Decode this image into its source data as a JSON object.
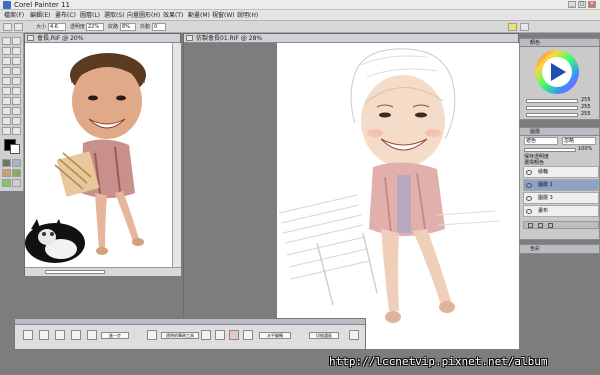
{
  "app": {
    "title": "Corel Painter 11",
    "window_controls": [
      "_",
      "□",
      "×"
    ]
  },
  "menu": [
    "檔案(F)",
    "編輯(E)",
    "畫布(C)",
    "圖層(L)",
    "選取(S)",
    "向量圖形(H)",
    "效果(T)",
    "動畫(M)",
    "視窗(W)",
    "說明(H)"
  ],
  "propbar": {
    "size_label": "大小",
    "size_value": "4.6",
    "opacity_label": "透明度",
    "opacity_value": "22%",
    "grain_label": "紋路",
    "grain_value": "8%",
    "resat_label": "抖動",
    "resat_value": "0"
  },
  "documents": {
    "source_title": "會長.RIF @ 20%",
    "target_title": "仿製會長01.RIF @ 28%"
  },
  "panels": {
    "color_title": "顏色",
    "color_values": [
      "255",
      "255",
      "255"
    ],
    "layers_title": "圖層",
    "blend_mode": "遮色",
    "composite": "忽略",
    "opacity": "100%",
    "options": [
      "保存透明度",
      "選擇顏色"
    ],
    "layers": [
      {
        "name": "繪輪"
      },
      {
        "name": "圖層 1",
        "selected": true
      },
      {
        "name": "圖層 3"
      },
      {
        "name": "畫布"
      }
    ],
    "bottom_title": "色彩"
  },
  "bottombar": {
    "buttons": [
      "進一步",
      "透明的筆刷工具",
      "水平翻轉",
      "切換選區"
    ]
  },
  "watermark": "http://lccnetvip.pixnet.net/album",
  "colors": {
    "canvas_gray": "#7d7d7d",
    "panel_gray": "#cacaca",
    "accent_blue": "#3a6fc0"
  }
}
